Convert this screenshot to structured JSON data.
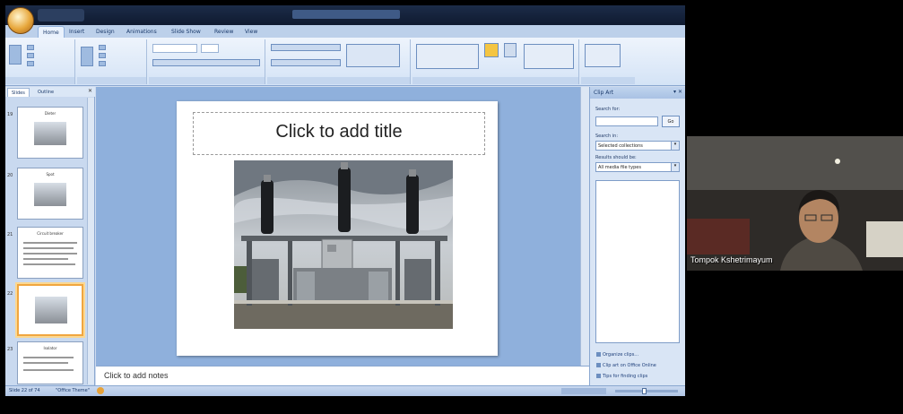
{
  "ribbon": {
    "tabs": [
      "Home",
      "Insert",
      "Design",
      "Animations",
      "Slide Show",
      "Review",
      "View"
    ],
    "active_tab": "Home"
  },
  "slides_pane": {
    "tabs": [
      "Slides",
      "Outline"
    ],
    "thumbnails": [
      {
        "number": "19",
        "title": "Dieter"
      },
      {
        "number": "20",
        "title": "Spot"
      },
      {
        "number": "21",
        "title": "Circuit breaker"
      },
      {
        "number": "22",
        "title": ""
      },
      {
        "number": "23",
        "title": "Isolator"
      }
    ],
    "selected_index": 3
  },
  "slide": {
    "title_placeholder": "Click to add title",
    "image": "substation-breaker-photo"
  },
  "notes": {
    "placeholder": "Click to add notes"
  },
  "clip_art": {
    "title": "Clip Art",
    "search_label": "Search for:",
    "search_value": "",
    "go_label": "Go",
    "search_in_label": "Search in:",
    "search_in_value": "Selected collections",
    "results_label": "Results should be:",
    "results_value": "All media file types",
    "links": [
      "Organize clips...",
      "Clip art on Office Online",
      "Tips for finding clips"
    ]
  },
  "status_bar": {
    "slide_count": "Slide 22 of 74",
    "theme": "\"Office Theme\""
  },
  "webcam": {
    "participant_name": "Tompok Kshetrimayum"
  },
  "colors": {
    "ribbon": "#d4e3f6",
    "slide_area": "#8fb0dc",
    "titlebar": "#1c2c48",
    "selection": "#f0a640"
  }
}
